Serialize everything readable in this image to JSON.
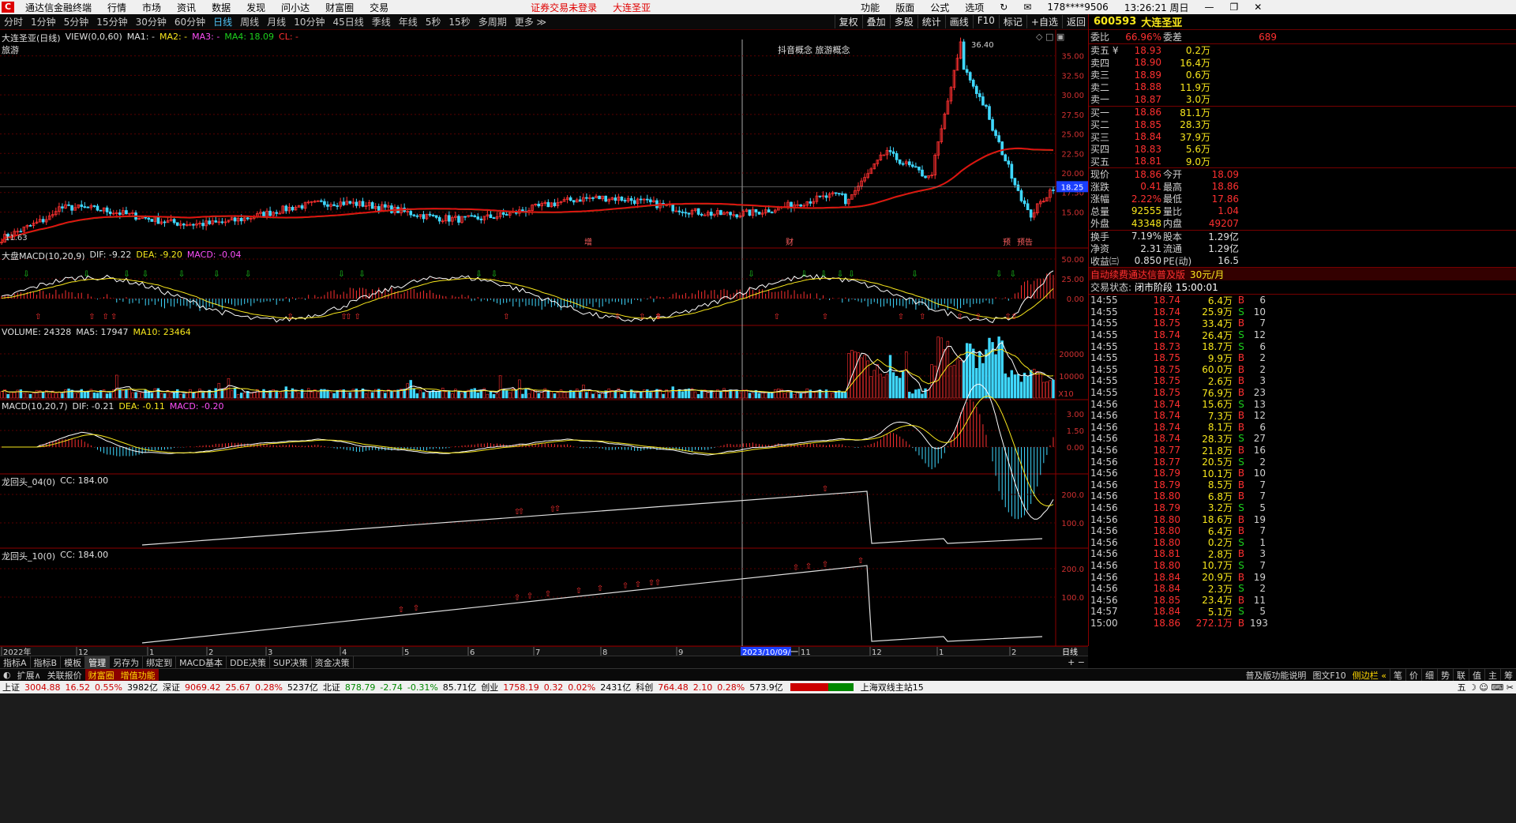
{
  "app": {
    "title": "通达信金融终端",
    "menu": [
      "行情",
      "市场",
      "资讯",
      "数据",
      "发现",
      "问小达",
      "财富圈",
      "交易"
    ],
    "warning": "证券交易未登录",
    "stock_tag": "大连圣亚",
    "right_menu": [
      "功能",
      "版面",
      "公式",
      "选项"
    ],
    "account": "178****9506",
    "clock": "13:26:21 周日"
  },
  "periods": {
    "items": [
      "分时",
      "1分钟",
      "5分钟",
      "15分钟",
      "30分钟",
      "60分钟",
      "日线",
      "周线",
      "月线",
      "10分钟",
      "45日线",
      "季线",
      "年线",
      "5秒",
      "15秒",
      "多周期",
      "更多 ≫"
    ],
    "active": "日线",
    "tools": [
      "复权",
      "叠加",
      "多股",
      "统计",
      "画线",
      "F10",
      "标记",
      "+自选",
      "返回"
    ]
  },
  "main_chart": {
    "title": "大连圣亚(日线)",
    "indicator": "VIEW(0,0,60)",
    "ma1": "MA1: -",
    "ma2": "MA2: -",
    "ma3": "MA3: -",
    "ma4": "MA4: 18.09",
    "cl": "CL: -",
    "sector": "旅游",
    "concept": "抖音概念 旅游概念",
    "high_label": "36.40",
    "low_label": "11.63",
    "price_tag": "18.25",
    "y_ticks": [
      "35.00",
      "32.50",
      "30.00",
      "27.50",
      "25.00",
      "22.50",
      "20.00",
      "17.50",
      "15.00"
    ],
    "markers": [
      "增",
      "财",
      "预",
      "预告"
    ]
  },
  "panel_macd_big": {
    "label": "大盘MACD(10,20,9)",
    "dif": "DIF: -9.22",
    "dea": "DEA: -9.20",
    "macd": "MACD: -0.04",
    "y_ticks": [
      "50.00",
      "25.00",
      "0.00"
    ]
  },
  "panel_volume": {
    "label": "VOLUME: 24328",
    "ma5": "MA5: 17947",
    "ma10": "MA10: 23464",
    "y_ticks": [
      "20000",
      "10000"
    ],
    "unit": "X10"
  },
  "panel_macd": {
    "label": "MACD(10,20,7)",
    "dif": "DIF: -0.21",
    "dea": "DEA: -0.11",
    "macd": "MACD: -0.20",
    "y_ticks": [
      "3.00",
      "1.50",
      "0.00"
    ]
  },
  "panel_lht4": {
    "label": "龙回头_04(0)",
    "cc": "CC: 184.00",
    "y_ticks": [
      "200.0",
      "100.0"
    ]
  },
  "panel_lht10": {
    "label": "龙回头_10(0)",
    "cc": "CC: 184.00",
    "y_ticks": [
      "200.0",
      "100.0"
    ]
  },
  "x_axis": {
    "labels": [
      "2022年",
      "12",
      "1",
      "2",
      "3",
      "4",
      "5",
      "6",
      "7",
      "8",
      "9",
      "11",
      "12",
      "1",
      "2"
    ],
    "cursor_date": "2023/10/09/一",
    "scale": "日线"
  },
  "bottom_tabs": [
    "指标A",
    "指标B",
    "模板",
    "管理",
    "另存为",
    "绑定到",
    "MACD基本",
    "DDE决策",
    "SUP决策",
    "资金决策"
  ],
  "bottom_tabs_active": "管理",
  "bottom_tabs2": [
    "扩展∧",
    "关联报价",
    "财富圈",
    "增值功能"
  ],
  "bottom_right": [
    "普及版功能说明",
    "图文F10",
    "侧边栏 «"
  ],
  "bottom_right_icons": [
    "笔",
    "价",
    "细",
    "势",
    "联",
    "值",
    "主",
    "筹"
  ],
  "statusbar": {
    "items": [
      {
        "label": "上证",
        "val": "3004.88",
        "chg": "16.52",
        "pct": "0.55%",
        "amt": "3982亿"
      },
      {
        "label": "深证",
        "val": "9069.42",
        "chg": "25.67",
        "pct": "0.28%",
        "amt": "5237亿"
      },
      {
        "label": "北证",
        "val": "878.79",
        "chg": "-2.74",
        "pct": "-0.31%",
        "amt": "85.71亿"
      },
      {
        "label": "创业",
        "val": "1758.19",
        "chg": "0.32",
        "pct": "0.02%",
        "amt": "2431亿"
      },
      {
        "label": "科创",
        "val": "764.48",
        "chg": "2.10",
        "pct": "0.28%",
        "amt": "573.9亿"
      }
    ],
    "server": "上海双线主站15"
  },
  "quote": {
    "code": "600593",
    "name": "大连圣亚",
    "weibi_label": "委比",
    "weibi": "66.96%",
    "weicha_label": "委差",
    "weicha": "689",
    "asks": [
      {
        "label": "卖五 ¥",
        "price": "18.93",
        "qty": "0.2万"
      },
      {
        "label": "卖四",
        "price": "18.90",
        "qty": "16.4万"
      },
      {
        "label": "卖三",
        "price": "18.89",
        "qty": "0.6万"
      },
      {
        "label": "卖二",
        "price": "18.88",
        "qty": "11.9万"
      },
      {
        "label": "卖一",
        "price": "18.87",
        "qty": "3.0万"
      }
    ],
    "bids": [
      {
        "label": "买一",
        "price": "18.86",
        "qty": "81.1万"
      },
      {
        "label": "买二",
        "price": "18.85",
        "qty": "28.3万"
      },
      {
        "label": "买三",
        "price": "18.84",
        "qty": "37.9万"
      },
      {
        "label": "买四",
        "price": "18.83",
        "qty": "5.6万"
      },
      {
        "label": "买五",
        "price": "18.81",
        "qty": "9.0万"
      }
    ],
    "stats": [
      {
        "l1": "现价",
        "v1": "18.86",
        "l2": "今开",
        "v2": "18.09"
      },
      {
        "l1": "涨跌",
        "v1": "0.41",
        "l2": "最高",
        "v2": "18.86"
      },
      {
        "l1": "涨幅",
        "v1": "2.22%",
        "l2": "最低",
        "v2": "17.86"
      },
      {
        "l1": "总量",
        "v1": "92555",
        "l2": "量比",
        "v2": "1.04"
      },
      {
        "l1": "外盘",
        "v1": "43348",
        "l2": "内盘",
        "v2": "49207"
      }
    ],
    "stats2": [
      {
        "l1": "换手",
        "v1": "7.19%",
        "l2": "股本",
        "v2": "1.29亿"
      },
      {
        "l1": "净资",
        "v1": "2.31",
        "l2": "流通",
        "v2": "1.29亿"
      },
      {
        "l1": "收益㈢",
        "v1": "0.850",
        "l2": "PE(动)",
        "v2": "16.5"
      }
    ],
    "promo": "自动续费通达信普及版",
    "promo_price": "30元/月",
    "trade_state_label": "交易状态:",
    "trade_state": "闭市阶段 15:00:01"
  },
  "ticks": [
    {
      "t": "14:55",
      "p": "18.74",
      "v": "6.4万",
      "bs": "B",
      "n": "6"
    },
    {
      "t": "14:55",
      "p": "18.74",
      "v": "25.9万",
      "bs": "S",
      "n": "10"
    },
    {
      "t": "14:55",
      "p": "18.75",
      "v": "33.4万",
      "bs": "B",
      "n": "7"
    },
    {
      "t": "14:55",
      "p": "18.74",
      "v": "26.4万",
      "bs": "S",
      "n": "12"
    },
    {
      "t": "14:55",
      "p": "18.73",
      "v": "18.7万",
      "bs": "S",
      "n": "6"
    },
    {
      "t": "14:55",
      "p": "18.75",
      "v": "9.9万",
      "bs": "B",
      "n": "2"
    },
    {
      "t": "14:55",
      "p": "18.75",
      "v": "60.0万",
      "bs": "B",
      "n": "2"
    },
    {
      "t": "14:55",
      "p": "18.75",
      "v": "2.6万",
      "bs": "B",
      "n": "3"
    },
    {
      "t": "14:55",
      "p": "18.75",
      "v": "76.9万",
      "bs": "B",
      "n": "23"
    },
    {
      "t": "14:56",
      "p": "18.74",
      "v": "15.6万",
      "bs": "S",
      "n": "13"
    },
    {
      "t": "14:56",
      "p": "18.74",
      "v": "7.3万",
      "bs": "B",
      "n": "12"
    },
    {
      "t": "14:56",
      "p": "18.74",
      "v": "8.1万",
      "bs": "B",
      "n": "6"
    },
    {
      "t": "14:56",
      "p": "18.74",
      "v": "28.3万",
      "bs": "S",
      "n": "27"
    },
    {
      "t": "14:56",
      "p": "18.77",
      "v": "21.8万",
      "bs": "B",
      "n": "16"
    },
    {
      "t": "14:56",
      "p": "18.77",
      "v": "20.5万",
      "bs": "S",
      "n": "2"
    },
    {
      "t": "14:56",
      "p": "18.79",
      "v": "10.1万",
      "bs": "B",
      "n": "10"
    },
    {
      "t": "14:56",
      "p": "18.79",
      "v": "8.5万",
      "bs": "B",
      "n": "7"
    },
    {
      "t": "14:56",
      "p": "18.80",
      "v": "6.8万",
      "bs": "B",
      "n": "7"
    },
    {
      "t": "14:56",
      "p": "18.79",
      "v": "3.2万",
      "bs": "S",
      "n": "5"
    },
    {
      "t": "14:56",
      "p": "18.80",
      "v": "18.6万",
      "bs": "B",
      "n": "19"
    },
    {
      "t": "14:56",
      "p": "18.80",
      "v": "6.4万",
      "bs": "B",
      "n": "7"
    },
    {
      "t": "14:56",
      "p": "18.80",
      "v": "0.2万",
      "bs": "S",
      "n": "1"
    },
    {
      "t": "14:56",
      "p": "18.81",
      "v": "2.8万",
      "bs": "B",
      "n": "3"
    },
    {
      "t": "14:56",
      "p": "18.80",
      "v": "10.7万",
      "bs": "S",
      "n": "7"
    },
    {
      "t": "14:56",
      "p": "18.84",
      "v": "20.9万",
      "bs": "B",
      "n": "19"
    },
    {
      "t": "14:56",
      "p": "18.84",
      "v": "2.3万",
      "bs": "S",
      "n": "2"
    },
    {
      "t": "14:56",
      "p": "18.85",
      "v": "23.4万",
      "bs": "B",
      "n": "11"
    },
    {
      "t": "14:57",
      "p": "18.84",
      "v": "5.1万",
      "bs": "S",
      "n": "5"
    },
    {
      "t": "15:00",
      "p": "18.86",
      "v": "272.1万",
      "bs": "B",
      "n": "193"
    }
  ],
  "colors": {
    "up": "#ff3030",
    "down": "#3fd8ff",
    "ma_yellow": "#f8e71c",
    "ma_white": "#ffffff",
    "grid_red": "#8b0000",
    "quote_yellow": "#f8e71c"
  }
}
